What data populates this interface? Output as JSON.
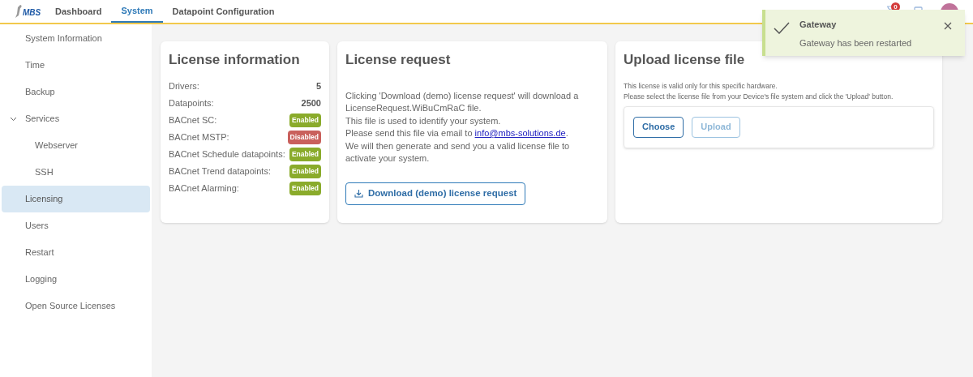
{
  "header": {
    "logo": "MBS",
    "tabs": [
      {
        "label": "Dashboard",
        "selected": false
      },
      {
        "label": "System",
        "selected": true
      },
      {
        "label": "Datapoint Configuration",
        "selected": false
      }
    ],
    "notification_count": "0"
  },
  "sidebar": {
    "items": [
      {
        "label": "System Information",
        "selected": false
      },
      {
        "label": "Time",
        "selected": false
      },
      {
        "label": "Backup",
        "selected": false
      },
      {
        "label": "Services",
        "selected": false,
        "expanded": true,
        "children": [
          {
            "label": "Webserver",
            "selected": false
          },
          {
            "label": "SSH",
            "selected": false
          }
        ]
      },
      {
        "label": "Licensing",
        "selected": true
      },
      {
        "label": "Users",
        "selected": false
      },
      {
        "label": "Restart",
        "selected": false
      },
      {
        "label": "Logging",
        "selected": false
      },
      {
        "label": "Open Source Licenses",
        "selected": false
      }
    ]
  },
  "license_information": {
    "title": "License information",
    "rows": [
      {
        "label": "Drivers:",
        "value": "5",
        "kind": "number"
      },
      {
        "label": "Datapoints:",
        "value": "2500",
        "kind": "number"
      },
      {
        "label": "BACnet SC:",
        "value": "Enabled",
        "kind": "badge",
        "enabled": true
      },
      {
        "label": "BACnet MSTP:",
        "value": "Disabled",
        "kind": "badge",
        "enabled": false
      },
      {
        "label": "BACnet Schedule datapoints:",
        "value": "Enabled",
        "kind": "badge",
        "enabled": true
      },
      {
        "label": "BACnet Trend datapoints:",
        "value": "Enabled",
        "kind": "badge",
        "enabled": true
      },
      {
        "label": "BACnet Alarming:",
        "value": "Enabled",
        "kind": "badge",
        "enabled": true
      }
    ]
  },
  "license_request": {
    "title": "License request",
    "lines": [
      {
        "text": "Clicking 'Download (demo) license request' will download a LicenseRequest.WiBuCmRaC file."
      },
      {
        "text": "This file is used to identify your system."
      },
      {
        "text": "Please send this file via email to ",
        "link": "info@mbs-solutions.de",
        "after": "."
      },
      {
        "text": "We will then generate and send you a valid license file to activate your system."
      }
    ],
    "button": "Download (demo) license request"
  },
  "upload_license": {
    "title": "Upload license file",
    "lines": [
      "This license is valid only for this specific hardware.",
      "Please select the license file from your Device's file system and click the 'Upload' button."
    ],
    "buttons": [
      {
        "label": "Choose",
        "disabled": false
      },
      {
        "label": "Upload",
        "disabled": true
      }
    ]
  },
  "toast": {
    "title": "Gateway",
    "message": "Gateway has been restarted"
  }
}
